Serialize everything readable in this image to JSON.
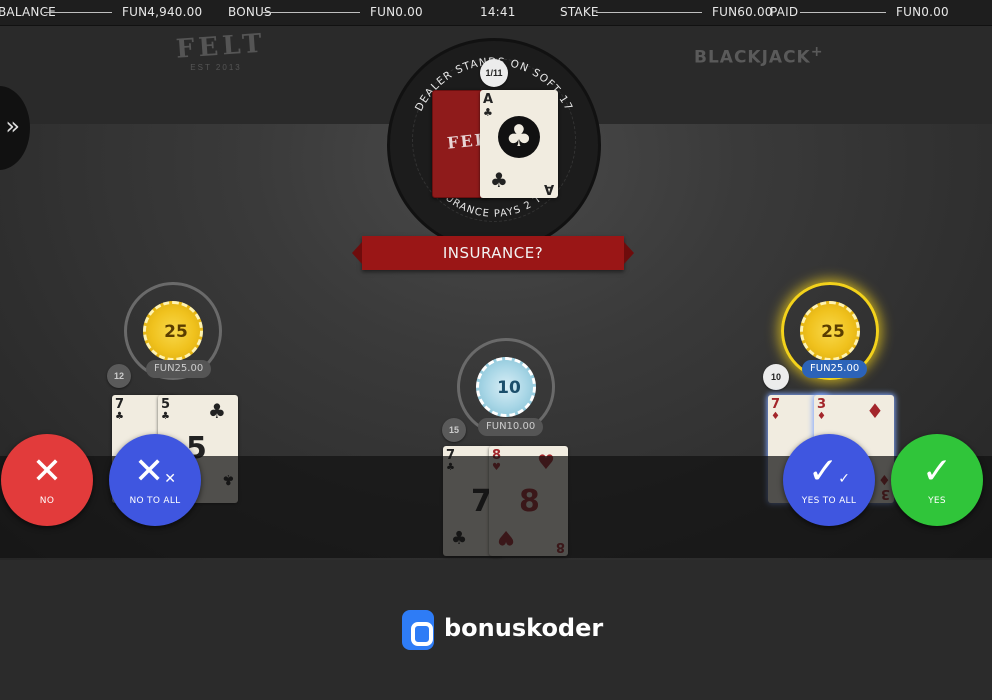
{
  "topbar": {
    "balance_label": "BALANCE",
    "balance_value": "FUN4,940.00",
    "bonus_label": "BONUS",
    "bonus_value": "FUN0.00",
    "clock": "14:41",
    "stake_label": "STAKE",
    "stake_value": "FUN60.00",
    "paid_label": "PAID",
    "paid_value": "FUN0.00"
  },
  "logos": {
    "felt_word": "FELT",
    "felt_est": "EST 2013",
    "game_name": "BLACKJACK",
    "game_plus": "+"
  },
  "side_panel": {
    "icon": "double-chevron-right"
  },
  "dealer": {
    "ring_text": "DEALER STANDS ON SOFT 17",
    "ring_text_bottom": "INSURANCE PAYS 2 TO 1",
    "card_count": "1/11",
    "up_card": {
      "rank": "A",
      "suit": "♣"
    },
    "hole_card_logo": "FELT"
  },
  "prompt": {
    "text": "INSURANCE?"
  },
  "seats": [
    {
      "chip_value": "25",
      "chip_color": "#f0c21e",
      "stake": "FUN25.00",
      "hand_total": "12",
      "cards": [
        {
          "rank": "7",
          "suit": "♣"
        },
        {
          "rank": "5",
          "suit": "♣"
        }
      ],
      "active": false
    },
    {
      "chip_value": "10",
      "chip_color": "#a8d6e6",
      "stake": "FUN10.00",
      "hand_total": "15",
      "cards": [
        {
          "rank": "7",
          "suit": "♣"
        },
        {
          "rank": "8",
          "suit": "♥"
        }
      ],
      "active": false
    },
    {
      "chip_value": "25",
      "chip_color": "#f0c21e",
      "stake": "FUN25.00",
      "hand_total": "10",
      "cards": [
        {
          "rank": "7",
          "suit": "♦"
        },
        {
          "rank": "3",
          "suit": "♦"
        }
      ],
      "active": true
    }
  ],
  "actions": {
    "no": {
      "label": "NO",
      "icon": "close-icon",
      "color": "#e23b3b"
    },
    "no_to_all": {
      "label": "NO TO ALL",
      "icon": "close-all-icon",
      "color": "#3f56e0"
    },
    "yes_to_all": {
      "label": "YES TO ALL",
      "icon": "check-all-icon",
      "color": "#3f56e0"
    },
    "yes": {
      "label": "YES",
      "icon": "check-icon",
      "color": "#30c53a"
    }
  },
  "footer": {
    "brand": "bonuskoder",
    "brand_color": "#2e7cf6"
  }
}
